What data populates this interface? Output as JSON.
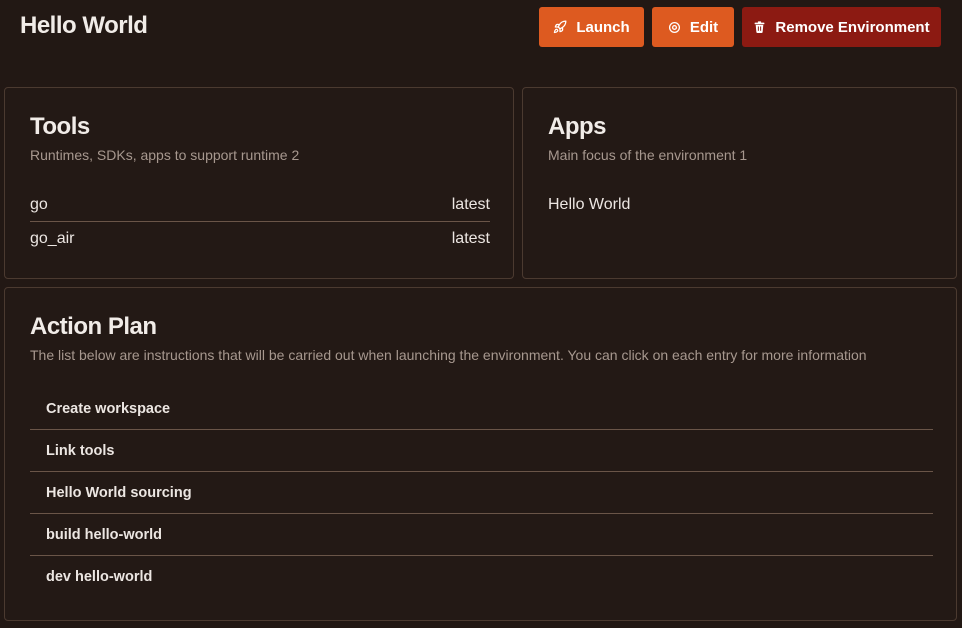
{
  "header": {
    "title": "Hello World",
    "buttons": {
      "launch": "Launch",
      "edit": "Edit",
      "remove": "Remove Environment"
    }
  },
  "tools": {
    "title": "Tools",
    "subtitle": "Runtimes, SDKs, apps to support runtime 2",
    "items": [
      {
        "name": "go",
        "version": "latest"
      },
      {
        "name": "go_air",
        "version": "latest"
      }
    ]
  },
  "apps": {
    "title": "Apps",
    "subtitle": "Main focus of the environment 1",
    "items": [
      {
        "name": "Hello World"
      }
    ]
  },
  "action_plan": {
    "title": "Action Plan",
    "subtitle": "The list below are instructions that will be carried out when launching the environment. You can click on each entry for more information",
    "items": [
      {
        "label": "Create workspace"
      },
      {
        "label": "Link tools"
      },
      {
        "label": "Hello World sourcing"
      },
      {
        "label": "build hello-world"
      },
      {
        "label": "dev hello-world"
      }
    ]
  },
  "colors": {
    "background": "#221814",
    "accent": "#dd5a20",
    "danger": "#8c1a12",
    "border": "#4b3a30"
  }
}
